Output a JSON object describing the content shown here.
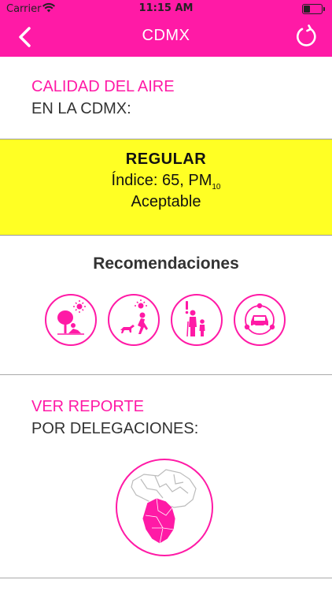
{
  "status_bar": {
    "carrier": "Carrier",
    "time": "11:15 AM"
  },
  "navbar": {
    "title": "CDMX",
    "back_icon": "chevron-left-icon",
    "refresh_icon": "refresh-icon"
  },
  "air_quality": {
    "title_line1": "CALIDAD DEL AIRE",
    "title_line2": "EN LA CDMX:",
    "level": "REGULAR",
    "index_text": "Índice: 65, PM",
    "index_subscript": "10",
    "status": "Aceptable",
    "background_color": "#ffff24"
  },
  "recommendations": {
    "title": "Recomendaciones",
    "icons": [
      "outdoor-activities-icon",
      "outdoor-exercise-icon",
      "vulnerable-groups-icon",
      "car-usage-icon"
    ]
  },
  "report": {
    "title_line1": "VER REPORTE",
    "title_line2": "POR DELEGACIONES:",
    "map_icon": "cdmx-delegaciones-map-icon"
  },
  "colors": {
    "accent": "#ff1aa6",
    "text_dark": "#333333"
  }
}
